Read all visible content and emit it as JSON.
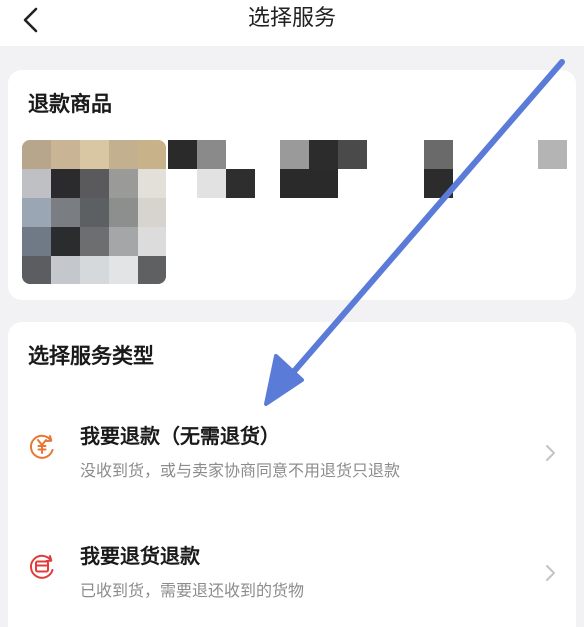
{
  "navbar": {
    "back_icon": "chevron-left-icon",
    "title": "选择服务"
  },
  "goods": {
    "section_title": "退款商品"
  },
  "service": {
    "section_title": "选择服务类型",
    "options": [
      {
        "icon": "yuan-refund-icon",
        "title": "我要退款（无需退货）",
        "description": "没收到货，或与卖家协商同意不用退货只退款",
        "chevron_icon": "chevron-right-icon"
      },
      {
        "icon": "return-box-icon",
        "title": "我要退货退款",
        "description": "已收到货，需要退还收到的货物",
        "chevron_icon": "chevron-right-icon"
      }
    ]
  },
  "colors": {
    "background": "#f2f2f4",
    "card": "#ffffff",
    "refund_icon": "#e87735",
    "return_icon": "#e23b3b",
    "annotation_arrow": "#5b7bd8",
    "secondary_text": "#8c8c8c"
  },
  "annotation": {
    "icon": "arrow-annotation-icon"
  }
}
